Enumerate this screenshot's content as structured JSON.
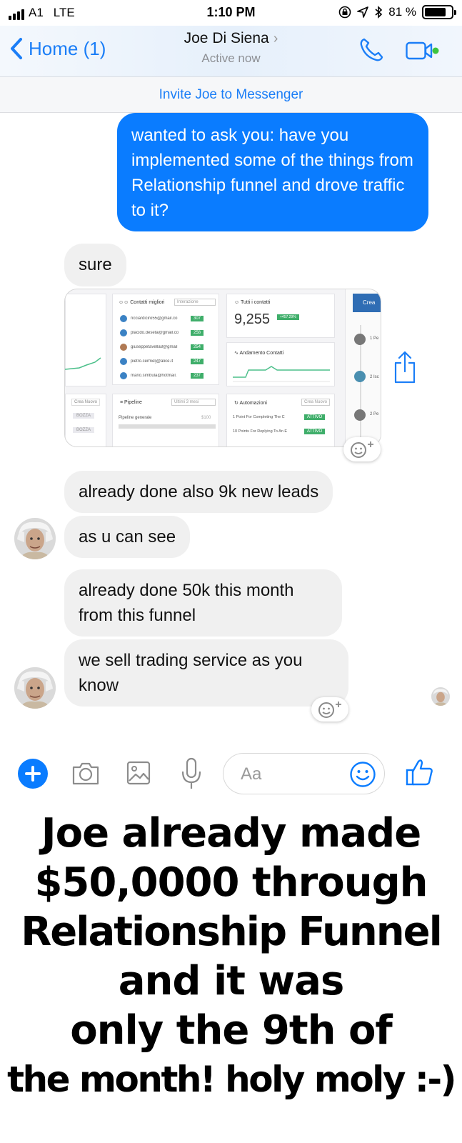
{
  "status_bar": {
    "carrier": "A1",
    "network": "LTE",
    "time": "1:10 PM",
    "battery_text": "81 %",
    "battery_level": 0.81,
    "icons": [
      "signal-icon",
      "lock-rotation-icon",
      "location-icon",
      "bluetooth-icon",
      "battery-icon"
    ]
  },
  "header": {
    "back_label": "Home (1)",
    "contact_name": "Joe Di Siena",
    "presence": "Active now",
    "accent_color": "#1b7ef7",
    "icons": [
      "chevron-left-icon",
      "chevron-right-icon",
      "phone-icon",
      "video-camera-icon"
    ]
  },
  "banner": {
    "invite_text": "Invite Joe to Messenger"
  },
  "conversation": {
    "outgoing_color": "#0a7cff",
    "incoming_color": "#f0f0f0",
    "messages": [
      {
        "side": "out",
        "text": "wanted to ask you: have you implemented some of the things from Relationship funnel and drove traffic to it?"
      },
      {
        "side": "in",
        "text": "sure"
      },
      {
        "side": "in",
        "type": "image"
      },
      {
        "side": "in",
        "text": "already done also 9k new leads"
      },
      {
        "side": "in",
        "text": "as u can see"
      },
      {
        "side": "in",
        "text": "already done 50k this month"
      },
      {
        "side": "in",
        "text": "from this funnel"
      },
      {
        "side": "in",
        "text": "we sell trading service as you know"
      }
    ]
  },
  "attachment": {
    "top_contacts_title": "Contatti migliori",
    "top_contacts_filter": "Interazione",
    "contacts": [
      {
        "email": "ricciardiciro55@gmail.co",
        "score": "307"
      },
      {
        "email": "placido.deseta@gmail.co",
        "score": "258"
      },
      {
        "email": "giuseppetavella8@gmail",
        "score": "254"
      },
      {
        "email": "pietro.cermelj@alice.it",
        "score": "247"
      },
      {
        "email": "mario.simbula@hotmail.",
        "score": "237"
      }
    ],
    "all_contacts_title": "Tutti i contatti",
    "all_contacts_value": "9,255",
    "all_contacts_delta": "+457.29%",
    "trend_title": "Andamento Contatti",
    "create_new": "Crea Nuovo",
    "pipeline_title": "Pipeline",
    "pipeline_filter": "Ultimi 3 mesi",
    "pipeline_item": "Pipeline generale",
    "pipeline_item_value": "$100",
    "automations_title": "Automazioni",
    "automations": [
      {
        "name": "1 Point For Completing The C",
        "status": "ATTIVO"
      },
      {
        "name": "10 Points For Replying To An E",
        "status": "ATTIVO"
      }
    ],
    "left_tags": [
      "BOZZA",
      "BOZZA"
    ],
    "right_button": "Crea",
    "timeline": [
      "1 Pe",
      "2 Isc",
      "2 Pe"
    ],
    "icons": [
      "share-icon",
      "add-reaction-icon"
    ]
  },
  "composer": {
    "placeholder": "Aa",
    "icons": [
      "plus-icon",
      "camera-icon",
      "image-icon",
      "microphone-icon",
      "emoji-icon",
      "thumbs-up-icon"
    ]
  },
  "caption": {
    "lines": [
      "Joe already made",
      "$50,0000 through",
      "Relationship Funnel",
      "and it was",
      "only the 9th of",
      "the month! holy moly :-)"
    ]
  }
}
